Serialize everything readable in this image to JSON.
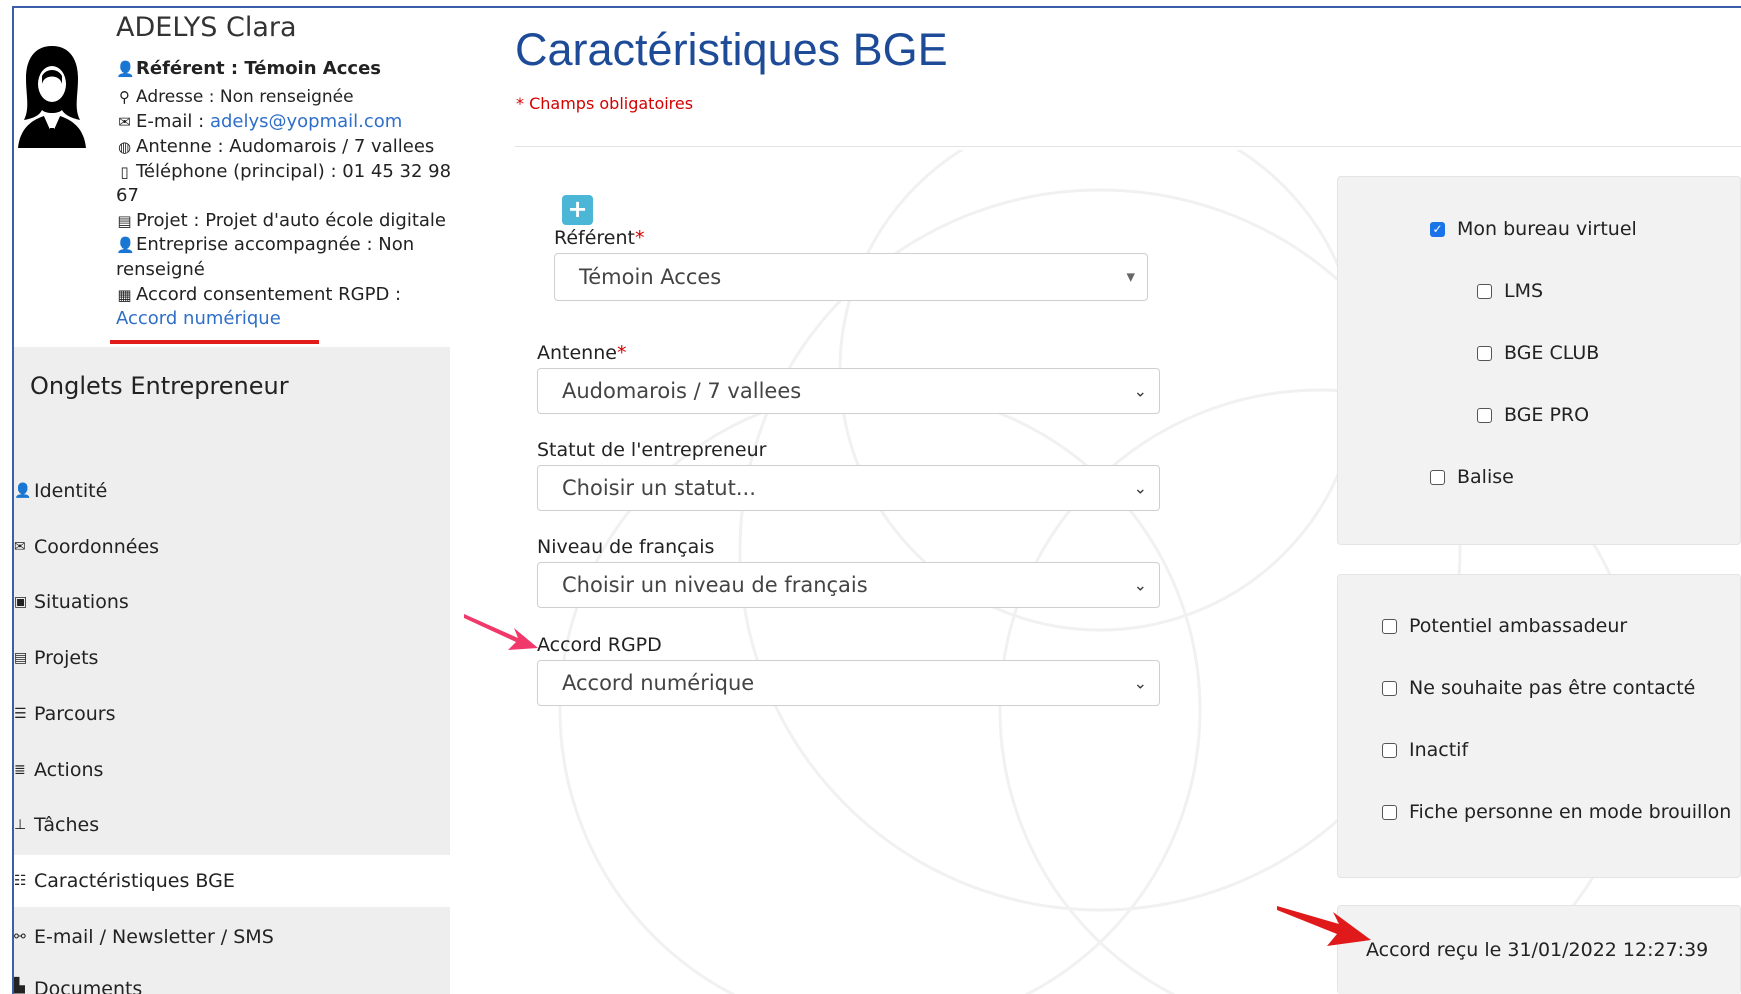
{
  "profile": {
    "name": "ADELYS Clara",
    "referent": "Référent : Témoin Acces",
    "address": "Adresse : Non renseignée",
    "email_label": "E-mail : ",
    "email_value": "adelys@yopmail.com",
    "antenne": "Antenne : Audomarois / 7 vallees",
    "phone_line1": "Téléphone (principal) : 01 45 32 98",
    "phone_line2": "67",
    "projet": "Projet : Projet d'auto école digitale",
    "entreprise_line1": "Entreprise accompagnée : Non",
    "entreprise_line2": "renseigné",
    "rgpd_label": "Accord consentement RGPD :",
    "rgpd_value": "Accord numérique"
  },
  "sidebar": {
    "title": "Onglets Entrepreneur",
    "items": [
      {
        "label": "Identité",
        "icon": "user-icon"
      },
      {
        "label": "Coordonnées",
        "icon": "envelope-icon"
      },
      {
        "label": "Situations",
        "icon": "briefcase-icon"
      },
      {
        "label": "Projets",
        "icon": "book-icon"
      },
      {
        "label": "Parcours",
        "icon": "list-alt-icon"
      },
      {
        "label": "Actions",
        "icon": "list-icon"
      },
      {
        "label": "Tâches",
        "icon": "pin-icon"
      },
      {
        "label": "Caractéristiques BGE",
        "icon": "database-icon",
        "active": true
      },
      {
        "label": "E-mail / Newsletter / SMS",
        "icon": "link-icon"
      },
      {
        "label": "Documents",
        "icon": "file-icon"
      }
    ]
  },
  "main": {
    "title": "Caractéristiques BGE",
    "required_note": "* Champs obligatoires",
    "add_button": "+",
    "referent": {
      "label": "Référent",
      "required": "*",
      "value": "Témoin Acces"
    },
    "antenne": {
      "label": "Antenne",
      "required": "*",
      "value": "Audomarois / 7 vallees"
    },
    "statut": {
      "label": "Statut de l'entrepreneur",
      "value": "Choisir un statut..."
    },
    "niveau": {
      "label": "Niveau de français",
      "value": "Choisir un niveau de français"
    },
    "rgpd": {
      "label": "Accord RGPD",
      "value": "Accord numérique"
    }
  },
  "panel1": {
    "items": [
      {
        "label": "Mon bureau virtuel",
        "checked": true
      },
      {
        "label": "LMS",
        "checked": false
      },
      {
        "label": "BGE CLUB",
        "checked": false
      },
      {
        "label": "BGE PRO",
        "checked": false
      },
      {
        "label": "Balise",
        "checked": false
      }
    ]
  },
  "panel2": {
    "items": [
      {
        "label": "Potentiel ambassadeur",
        "checked": false
      },
      {
        "label": "Ne souhaite pas être contacté",
        "checked": false
      },
      {
        "label": "Inactif",
        "checked": false
      },
      {
        "label": "Fiche personne en mode brouillon",
        "checked": false
      }
    ]
  },
  "accord_note": "Accord reçu le 31/01/2022 12:27:39",
  "colors": {
    "title": "#1e4b97",
    "required": "#d40000",
    "link": "#2f6fc8",
    "checkbox": "#1a73e8",
    "add_button": "#4cb6d6"
  }
}
